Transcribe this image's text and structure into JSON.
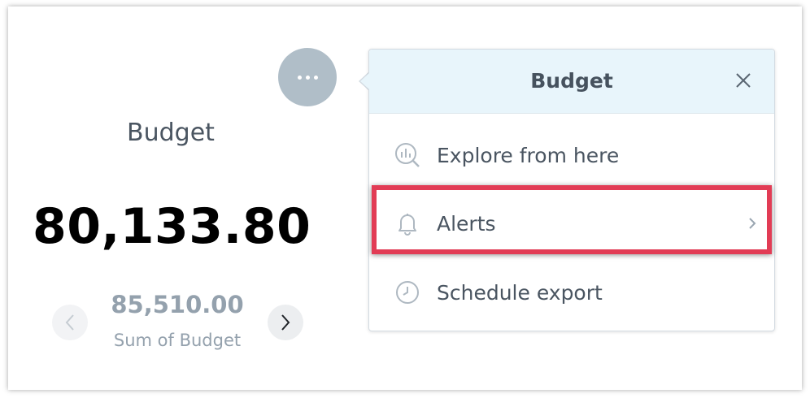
{
  "kpi": {
    "title": "Budget",
    "value": "80,133.80",
    "comparison_value": "85,510.00",
    "comparison_label": "Sum of Budget"
  },
  "popover": {
    "title": "Budget",
    "items": [
      {
        "label": "Explore from here",
        "icon": "explore-chart-icon"
      },
      {
        "label": "Alerts",
        "icon": "bell-icon"
      },
      {
        "label": "Schedule export",
        "icon": "clock-icon"
      }
    ]
  },
  "colors": {
    "header_bg": "#e8f5fb",
    "highlight": "#e23c55",
    "more_button": "#b0bec8",
    "text": "#4a5561",
    "muted": "#94a1ad"
  }
}
